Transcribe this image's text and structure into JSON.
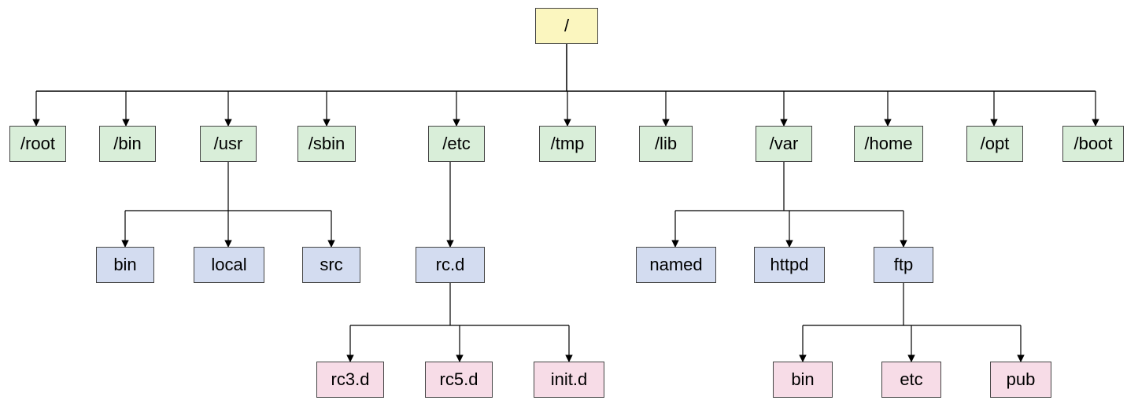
{
  "tree": {
    "root": "/",
    "level1": [
      "/root",
      "/bin",
      "/usr",
      "/sbin",
      "/etc",
      "/tmp",
      "/lib",
      "/var",
      "/home",
      "/opt",
      "/boot"
    ],
    "usr_children": [
      "bin",
      "local",
      "src"
    ],
    "etc_children": [
      "rc.d"
    ],
    "var_children": [
      "named",
      "httpd",
      "ftp"
    ],
    "rcd_children": [
      "rc3.d",
      "rc5.d",
      "init.d"
    ],
    "ftp_children": [
      "bin",
      "etc",
      "pub"
    ]
  }
}
